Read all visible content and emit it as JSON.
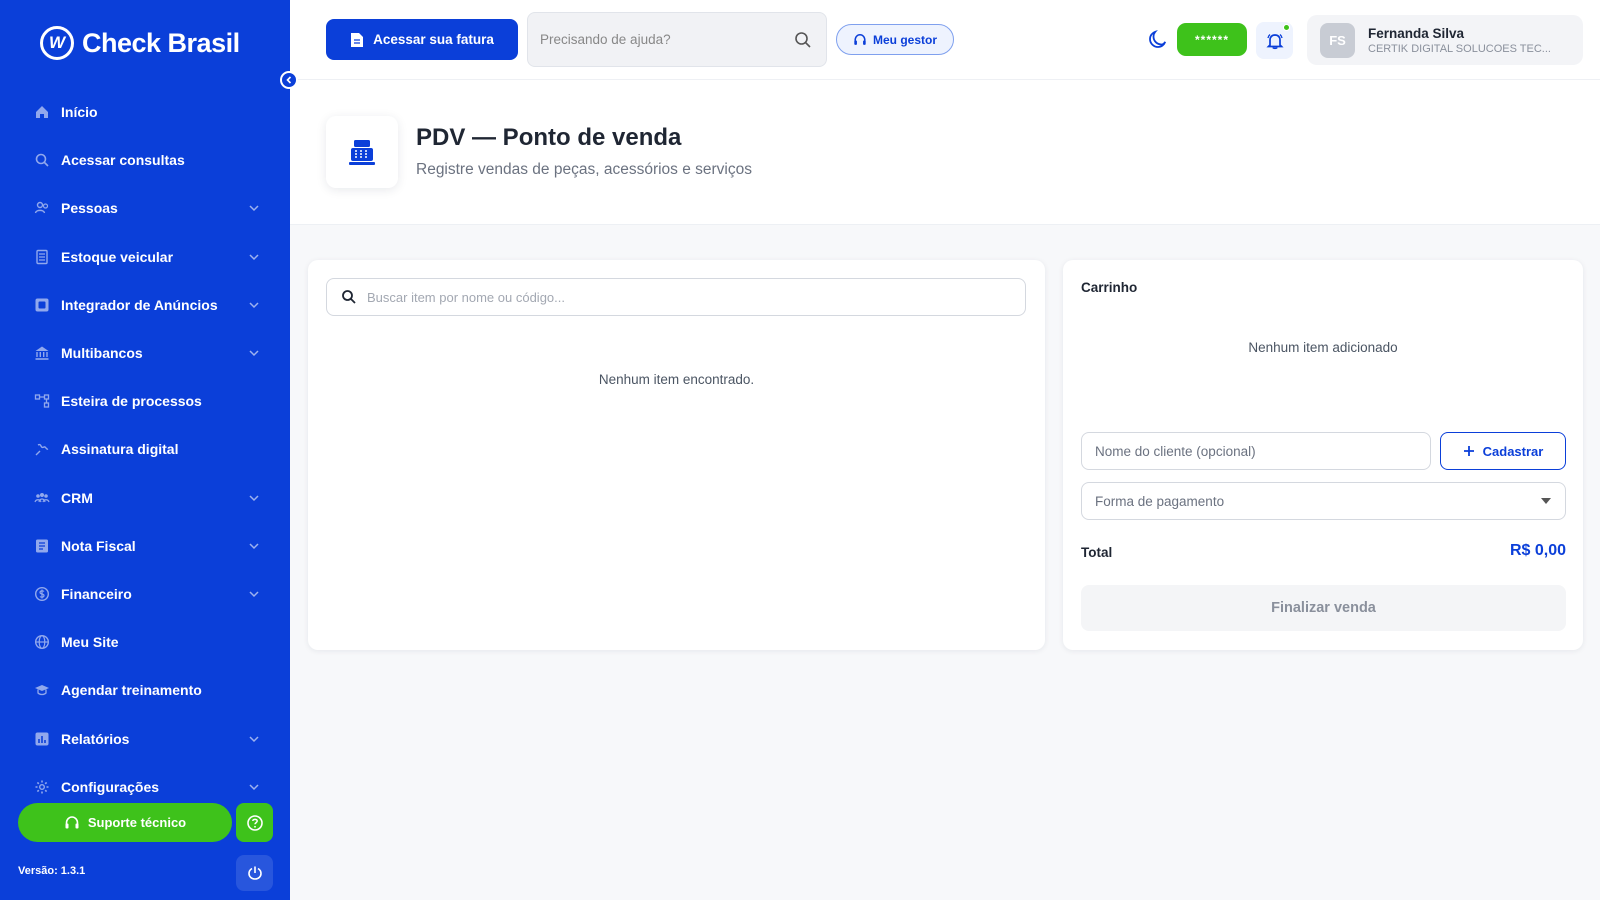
{
  "brand": {
    "name": "Check Brasil",
    "logo_letter": "W"
  },
  "colors": {
    "primary": "#0b3fd9",
    "success": "#3ec21b",
    "muted": "#8a909c"
  },
  "sidebar": {
    "items": [
      {
        "label": "Início",
        "icon": "home-icon",
        "has_submenu": false
      },
      {
        "label": "Acessar consultas",
        "icon": "search-icon",
        "has_submenu": false
      },
      {
        "label": "Pessoas",
        "icon": "users-icon",
        "has_submenu": true
      },
      {
        "label": "Estoque veicular",
        "icon": "car-stock-icon",
        "has_submenu": true
      },
      {
        "label": "Integrador de Anúncios",
        "icon": "ads-icon",
        "has_submenu": true
      },
      {
        "label": "Multibancos",
        "icon": "bank-icon",
        "has_submenu": true
      },
      {
        "label": "Esteira de processos",
        "icon": "flow-icon",
        "has_submenu": false
      },
      {
        "label": "Assinatura digital",
        "icon": "signature-icon",
        "has_submenu": false
      },
      {
        "label": "CRM",
        "icon": "crm-icon",
        "has_submenu": true
      },
      {
        "label": "Nota Fiscal",
        "icon": "invoice-icon",
        "has_submenu": true
      },
      {
        "label": "Financeiro",
        "icon": "finance-icon",
        "has_submenu": true
      },
      {
        "label": "Meu Site",
        "icon": "globe-icon",
        "has_submenu": false
      },
      {
        "label": "Agendar treinamento",
        "icon": "training-icon",
        "has_submenu": false
      },
      {
        "label": "Relatórios",
        "icon": "reports-icon",
        "has_submenu": true
      },
      {
        "label": "Configurações",
        "icon": "gear-icon",
        "has_submenu": true
      }
    ],
    "support_label": "Suporte técnico",
    "version": "Versão: 1.3.1"
  },
  "topbar": {
    "fatura_label": "Acessar sua fatura",
    "help_placeholder": "Precisando de ajuda?",
    "gestor_label": "Meu gestor",
    "password_badge": "******",
    "user": {
      "initials": "FS",
      "name": "Fernanda Silva",
      "company": "CERTIK DIGITAL SOLUCOES TEC..."
    }
  },
  "page": {
    "title": "PDV — Ponto de venda",
    "subtitle": "Registre vendas de peças, acessórios e serviços"
  },
  "items_panel": {
    "search_placeholder": "Buscar item por nome ou código...",
    "empty_text": "Nenhum item encontrado."
  },
  "cart": {
    "title": "Carrinho",
    "empty_text": "Nenhum item adicionado",
    "client_placeholder": "Nome do cliente (opcional)",
    "register_label": "Cadastrar",
    "payment_placeholder": "Forma de pagamento",
    "total_label": "Total",
    "total_value": "R$ 0,00",
    "finish_label": "Finalizar venda"
  }
}
